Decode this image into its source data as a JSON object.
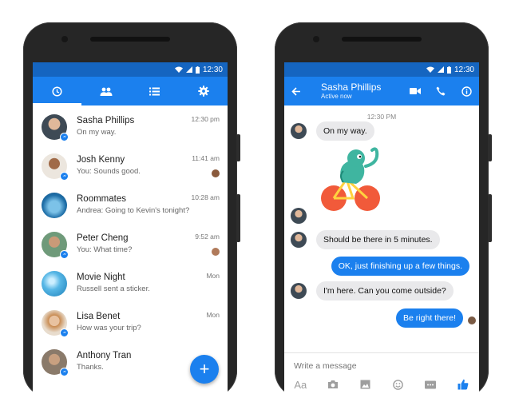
{
  "status": {
    "time": "12:30"
  },
  "left": {
    "tabs": [
      {
        "icon": "clock-icon",
        "name": "recent"
      },
      {
        "icon": "people-icon",
        "name": "people"
      },
      {
        "icon": "list-icon",
        "name": "groups"
      },
      {
        "icon": "gear-icon",
        "name": "settings"
      }
    ],
    "threads": [
      {
        "name": "Sasha Phillips",
        "snippet": "On my way.",
        "time": "12:30 pm",
        "avatar_color": "#4a5560"
      },
      {
        "name": "Josh Kenny",
        "snippet": "You: Sounds good.",
        "time": "11:41 am",
        "avatar_color": "#5a4030"
      },
      {
        "name": "Roommates",
        "snippet": "Andrea: Going to Kevin's tonight?",
        "time": "10:28 am",
        "avatar_color": "#2f7fb0"
      },
      {
        "name": "Peter Cheng",
        "snippet": "You: What time?",
        "time": "9:52 am",
        "avatar_color": "#6a8a70"
      },
      {
        "name": "Movie Night",
        "snippet": "Russell sent a sticker.",
        "time": "Mon",
        "avatar_color": "#3a9fd0"
      },
      {
        "name": "Lisa Benet",
        "snippet": "How was your trip?",
        "time": "Mon",
        "avatar_color": "#c89060"
      },
      {
        "name": "Anthony Tran",
        "snippet": "Thanks.",
        "time": "",
        "avatar_color": "#7a6a5a"
      }
    ],
    "fab_label": "+"
  },
  "right": {
    "contact_name": "Sasha Phillips",
    "presence": "Active now",
    "timestamp": "12:30 PM",
    "messages": [
      {
        "dir": "in",
        "text": "On my way."
      },
      {
        "dir": "in",
        "text": "Should be there in 5 minutes."
      },
      {
        "dir": "out",
        "text": "OK, just finishing up a few things."
      },
      {
        "dir": "in",
        "text": "I'm here. Can you come outside?"
      },
      {
        "dir": "out",
        "text": "Be right there!"
      }
    ],
    "composer_placeholder": "Write a message",
    "font_tool_label": "Aa"
  },
  "colors": {
    "accent": "#1b80ee",
    "status_bar": "#1565c0"
  }
}
